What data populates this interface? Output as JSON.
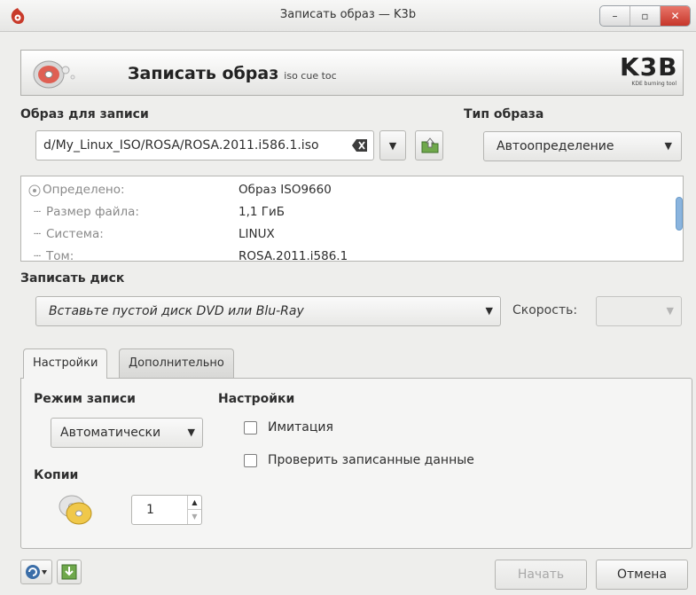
{
  "window": {
    "title": "Записать образ — K3b",
    "controls": [
      "minimize",
      "maximize",
      "close"
    ],
    "control_glyphs": {
      "minimize": "–",
      "maximize": "▫",
      "close": "✕"
    }
  },
  "banner": {
    "title": "Записать образ",
    "subtitle": "iso cue toc",
    "logo_text": "K3B",
    "logo_tagline": "KDE burning tool"
  },
  "image_section": {
    "label": "Образ для записи",
    "path": "d/My_Linux_ISO/ROSA/ROSA.2011.i586.1.iso",
    "dropdown_glyph": "▼"
  },
  "image_type": {
    "label": "Тип образа",
    "value": "Автоопределение",
    "dropdown_glyph": "▼"
  },
  "info_tree": {
    "rows": [
      {
        "key": "Определено:",
        "value": "Образ ISO9660"
      },
      {
        "key": "Размер файла:",
        "value": "1,1 ГиБ"
      },
      {
        "key": "Система:",
        "value": "LINUX"
      },
      {
        "key": "Том:",
        "value": "ROSA.2011.i586.1"
      }
    ]
  },
  "burn_disc": {
    "label": "Записать диск",
    "media_value": "Вставьте пустой диск DVD или Blu-Ray",
    "speed_label": "Скорость:",
    "dropdown_glyph": "▼"
  },
  "tabs": [
    {
      "label": "Настройки",
      "active": true
    },
    {
      "label": "Дополнительно",
      "active": false
    }
  ],
  "settings_tab": {
    "write_mode_label": "Режим записи",
    "write_mode_value": "Автоматически",
    "options_label": "Настройки",
    "options": [
      {
        "label": "Имитация",
        "checked": false
      },
      {
        "label": "Проверить записанные данные",
        "checked": false
      }
    ],
    "copies_label": "Копии",
    "copies_value": "1",
    "spin_up_glyph": "▲",
    "spin_down_glyph": "▼",
    "dropdown_glyph": "▼"
  },
  "footer": {
    "start_label": "Начать",
    "start_enabled": false,
    "cancel_label": "Отмена"
  },
  "colors": {
    "window_bg": "#eeeeec",
    "close_button": "#c6362a",
    "scroll_thumb": "#8ab4de"
  },
  "icons": [
    "k3b-app-icon",
    "disc-icon",
    "clear-text-icon",
    "open-folder-icon",
    "cd-copies-icon",
    "profile-icon",
    "save-profile-icon"
  ]
}
